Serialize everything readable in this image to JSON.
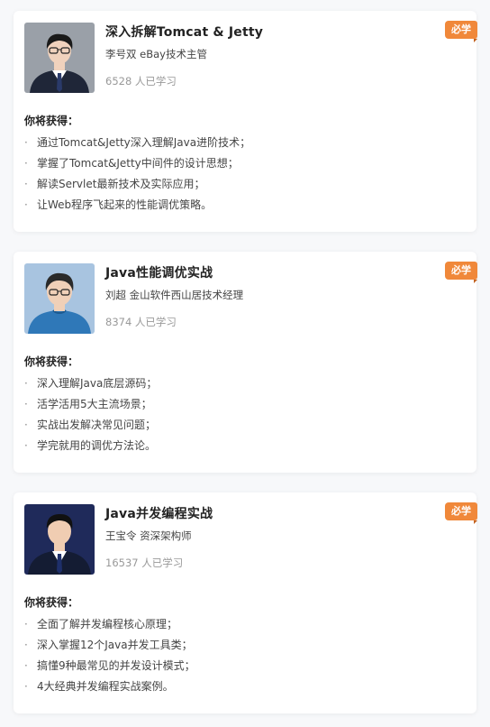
{
  "courses": [
    {
      "title": "深入拆解Tomcat & Jetty",
      "author": "李号双 eBay技术主管",
      "learners": "6528 人已学习",
      "badge": "必学",
      "gains_heading": "你将获得：",
      "gains": [
        "通过Tomcat&Jetty深入理解Java进阶技术；",
        "掌握了Tomcat&Jetty中间件的设计思想；",
        "解读Servlet最新技术及实际应用；",
        "让Web程序飞起来的性能调优策略。"
      ],
      "avatar": {
        "bg": "#9aa0a8",
        "suit": "#1f2638",
        "hair": "#1a1a1a",
        "skin": "#f0d2bd",
        "tie": "#2a3a6a",
        "glasses": true
      }
    },
    {
      "title": "Java性能调优实战",
      "author": "刘超 金山软件西山居技术经理",
      "learners": "8374 人已学习",
      "badge": "必学",
      "gains_heading": "你将获得：",
      "gains": [
        "深入理解Java底层源码；",
        "活学活用5大主流场景；",
        "实战出发解决常见问题；",
        "学完就用的调优方法论。"
      ],
      "avatar": {
        "bg": "#a8c4e0",
        "suit": "#2f78b8",
        "hair": "#2a2a2a",
        "skin": "#f0d0b8",
        "tie": "",
        "glasses": true
      }
    },
    {
      "title": "Java并发编程实战",
      "author": "王宝令 资深架构师",
      "learners": "16537 人已学习",
      "badge": "必学",
      "gains_heading": "你将获得：",
      "gains": [
        "全面了解并发编程核心原理；",
        "深入掌握12个Java并发工具类；",
        "搞懂9种最常见的并发设计模式；",
        "4大经典并发编程实战案例。"
      ],
      "avatar": {
        "bg": "#1f2a5a",
        "suit": "#141c33",
        "hair": "#111111",
        "skin": "#f0cdb2",
        "tie": "#1e2f6a",
        "glasses": false
      }
    }
  ],
  "colors": {
    "badge": "#f0883a",
    "background": "#f7f8fa"
  }
}
